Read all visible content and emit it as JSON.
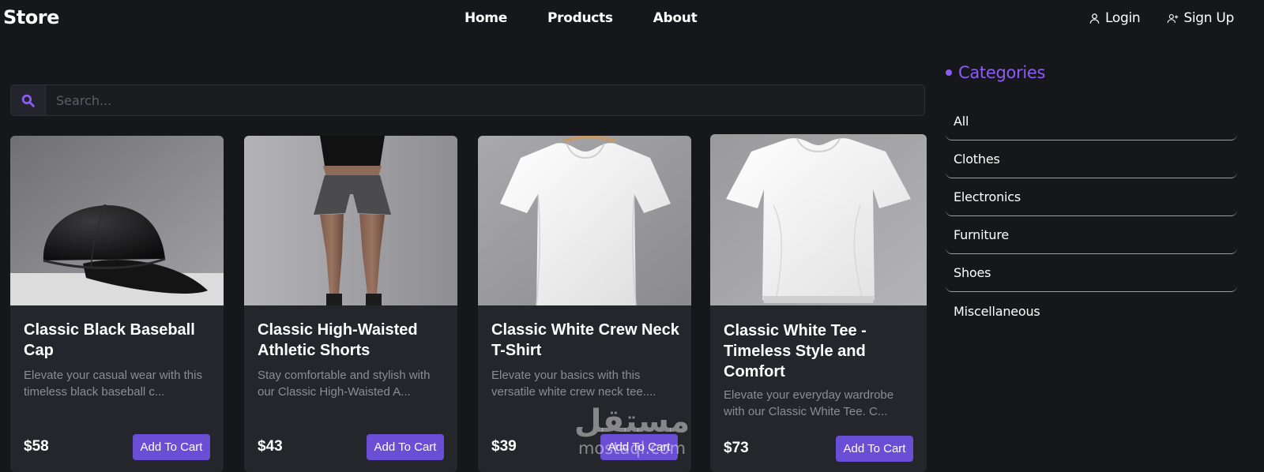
{
  "nav": {
    "brand": "Store",
    "links": [
      "Home",
      "Products",
      "About"
    ],
    "login": "Login",
    "signup": "Sign Up"
  },
  "search": {
    "placeholder": "Search..."
  },
  "products": [
    {
      "title": "Classic Black Baseball Cap",
      "desc": "Elevate your casual wear with this timeless black baseball c...",
      "price": "$58",
      "cta": "Add To Cart"
    },
    {
      "title": "Classic High-Waisted Athletic Shorts",
      "desc": "Stay comfortable and stylish with our Classic High-Waisted A...",
      "price": "$43",
      "cta": "Add To Cart"
    },
    {
      "title": "Classic White Crew Neck T-Shirt",
      "desc": "Elevate your basics with this versatile white crew neck tee....",
      "price": "$39",
      "cta": "Add To Cart"
    },
    {
      "title": "Classic White Tee - Timeless Style and Comfort",
      "desc": "Elevate your everyday wardrobe with our Classic White Tee. C...",
      "price": "$73",
      "cta": "Add To Cart"
    }
  ],
  "categories": {
    "title": "Categories",
    "items": [
      "All",
      "Clothes",
      "Electronics",
      "Furniture",
      "Shoes",
      "Miscellaneous"
    ]
  },
  "watermark": {
    "arabic": "مستقل",
    "latin": "mostaql.com"
  },
  "colors": {
    "accent": "#6a4ed6",
    "category_heading": "#8b5cf6",
    "background": "#16171b",
    "card": "#25262b"
  }
}
